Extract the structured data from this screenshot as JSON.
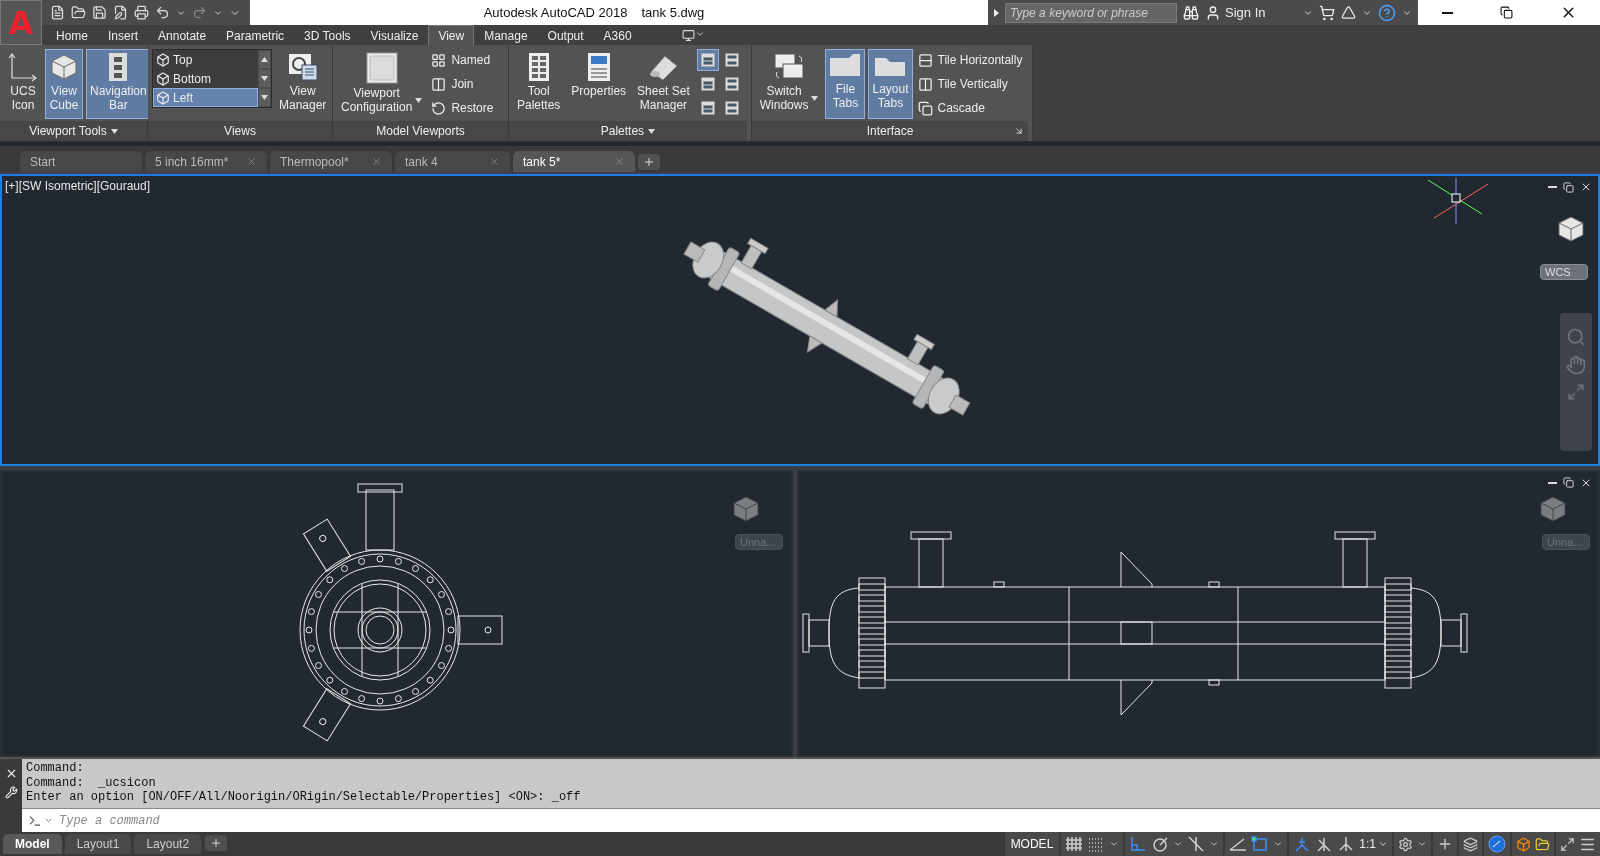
{
  "app_button": {
    "label": "A"
  },
  "title_bar": {
    "app": "Autodesk AutoCAD 2018",
    "document": "tank 5.dwg",
    "search_placeholder": "Type a keyword or phrase",
    "sign_in": "Sign In"
  },
  "ribbon_tabs": [
    {
      "label": "Home",
      "selected": false
    },
    {
      "label": "Insert",
      "selected": false
    },
    {
      "label": "Annotate",
      "selected": false
    },
    {
      "label": "Parametric",
      "selected": false
    },
    {
      "label": "3D Tools",
      "selected": false
    },
    {
      "label": "Visualize",
      "selected": false
    },
    {
      "label": "View",
      "selected": true
    },
    {
      "label": "Manage",
      "selected": false
    },
    {
      "label": "Output",
      "selected": false
    },
    {
      "label": "A360",
      "selected": false
    }
  ],
  "panels": [
    {
      "title": "Viewport Tools",
      "menu": true,
      "launcher": false,
      "tools": [
        {
          "kind": "large",
          "label": "UCS\nIcon",
          "selected": false
        },
        {
          "kind": "large",
          "label": "View\nCube",
          "selected": true
        },
        {
          "kind": "large",
          "label": "Navigation\nBar",
          "selected": true
        }
      ]
    },
    {
      "title": "Views",
      "menu": false,
      "launcher": false,
      "tools": [
        {
          "kind": "list",
          "items": [
            {
              "label": "Top",
              "selected": false
            },
            {
              "label": "Bottom",
              "selected": false
            },
            {
              "label": "Left",
              "selected": true
            }
          ]
        },
        {
          "kind": "large",
          "label": "View\nManager",
          "selected": false
        }
      ]
    },
    {
      "title": "Model Viewports",
      "menu": false,
      "launcher": false,
      "tools": [
        {
          "kind": "large",
          "label": "Viewport\nConfiguration",
          "selected": false,
          "dropdown": true
        },
        {
          "kind": "small",
          "items": [
            "Named",
            "Join",
            "Restore"
          ]
        }
      ]
    },
    {
      "title": "Palettes",
      "menu": true,
      "launcher": false,
      "tools": [
        {
          "kind": "large",
          "label": "Tool\nPalettes",
          "selected": false
        },
        {
          "kind": "large",
          "label": "Properties",
          "selected": false
        },
        {
          "kind": "large",
          "label": "Sheet Set\nManager",
          "selected": false
        },
        {
          "kind": "grid"
        }
      ]
    },
    {
      "title": "Interface",
      "menu": false,
      "launcher": true,
      "tools": [
        {
          "kind": "large",
          "label": "Switch\nWindows",
          "selected": false,
          "dropdown": true
        },
        {
          "kind": "large",
          "label": "File\nTabs",
          "selected": true
        },
        {
          "kind": "large",
          "label": "Layout\nTabs",
          "selected": true
        },
        {
          "kind": "small",
          "items": [
            "Tile Horizontally",
            "Tile Vertically",
            "Cascade"
          ]
        }
      ]
    }
  ],
  "file_tabs": [
    {
      "label": "Start",
      "selected": false,
      "closable": false
    },
    {
      "label": "5 inch 16mm*",
      "selected": false,
      "closable": true
    },
    {
      "label": "Thermopool*",
      "selected": false,
      "closable": true
    },
    {
      "label": "tank 4",
      "selected": false,
      "closable": true
    },
    {
      "label": "tank 5*",
      "selected": true,
      "closable": true
    }
  ],
  "viewports": [
    {
      "label": "[+][SW Isometric][Gouraud]",
      "active": true,
      "kind": "isometric",
      "ucs": "WCS"
    },
    {
      "active": false,
      "kind": "end",
      "ucs": "Unna..."
    },
    {
      "active": false,
      "kind": "side",
      "ucs": "Unna..."
    }
  ],
  "command": {
    "history": [
      "Command:",
      "Command:  _ucsicon",
      "Enter an option [ON/OFF/All/Noorigin/ORigin/Selectable/Properties] <ON>: _off"
    ],
    "placeholder": "Type a command"
  },
  "layout_tabs": [
    {
      "label": "Model",
      "selected": true
    },
    {
      "label": "Layout1",
      "selected": false
    },
    {
      "label": "Layout2",
      "selected": false
    }
  ],
  "status_bar": {
    "space": "MODEL",
    "scale": "1:1",
    "toggles": [
      {
        "kind": "grid",
        "on": false
      },
      {
        "kind": "snap",
        "on": false
      },
      {
        "kind": "ortho",
        "on": true
      },
      {
        "kind": "polar",
        "on": false
      },
      {
        "kind": "isodraft",
        "on": false
      },
      {
        "kind": "tracking",
        "on": false
      },
      {
        "kind": "osnap",
        "on": true
      },
      {
        "kind": "annovis",
        "on": true
      },
      {
        "kind": "autoscale",
        "on": false
      },
      {
        "kind": "annoscale",
        "on": false
      }
    ]
  }
}
